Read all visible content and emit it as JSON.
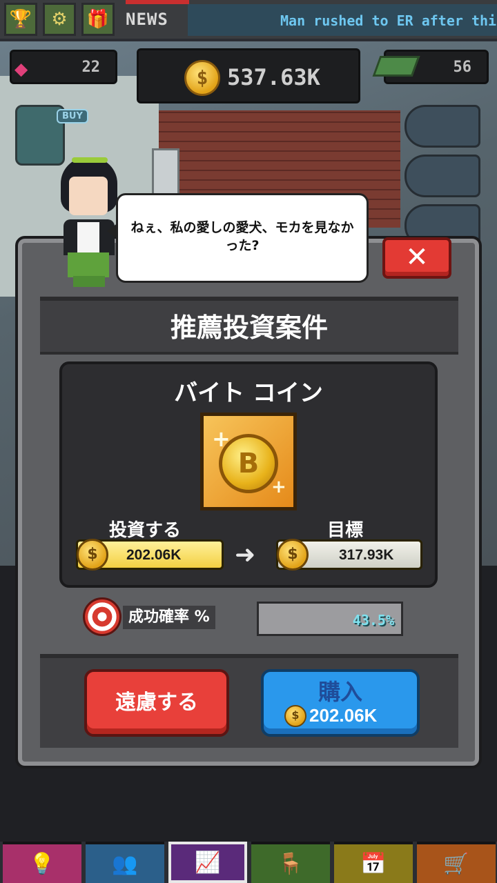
{
  "topbar": {
    "news_label": "NEWS",
    "news_ticker": "Man rushed to ER after think",
    "icons": [
      "trophy-icon",
      "gear-icon",
      "gift-icon"
    ]
  },
  "resources": {
    "gems": "22",
    "coins": "537.63K",
    "cash": "56"
  },
  "buy_badge": "BUY",
  "speech": {
    "text": "ねぇ、私の愛しの愛犬、モカを見なかった?"
  },
  "dialog": {
    "title": "推薦投資案件",
    "coin_name": "バイト コイン",
    "invest_label": "投資する",
    "target_label": "目標",
    "invest_amount": "202.06K",
    "target_amount": "317.93K",
    "success_label": "成功確率 %",
    "success_rate": "43.5%",
    "decline_label": "遠慮する",
    "buy_label": "購入",
    "buy_price": "202.06K",
    "close_symbol": "✕",
    "coin_symbol": "$",
    "bitcoin_symbol": "B"
  },
  "colors": {
    "decline": "#e8403a",
    "buy": "#2a98ec",
    "success_text": "#7fe1ee"
  },
  "bottom_nav": [
    {
      "icon": "lightbulb-icon",
      "color": "#a8306a"
    },
    {
      "icon": "people-icon",
      "color": "#2b5f8a"
    },
    {
      "icon": "chart-icon",
      "color": "#5a2a7a"
    },
    {
      "icon": "chair-icon",
      "color": "#3e6a2a"
    },
    {
      "icon": "calendar-icon",
      "color": "#8a7a1a"
    },
    {
      "icon": "cart-icon",
      "color": "#a8541a"
    }
  ]
}
